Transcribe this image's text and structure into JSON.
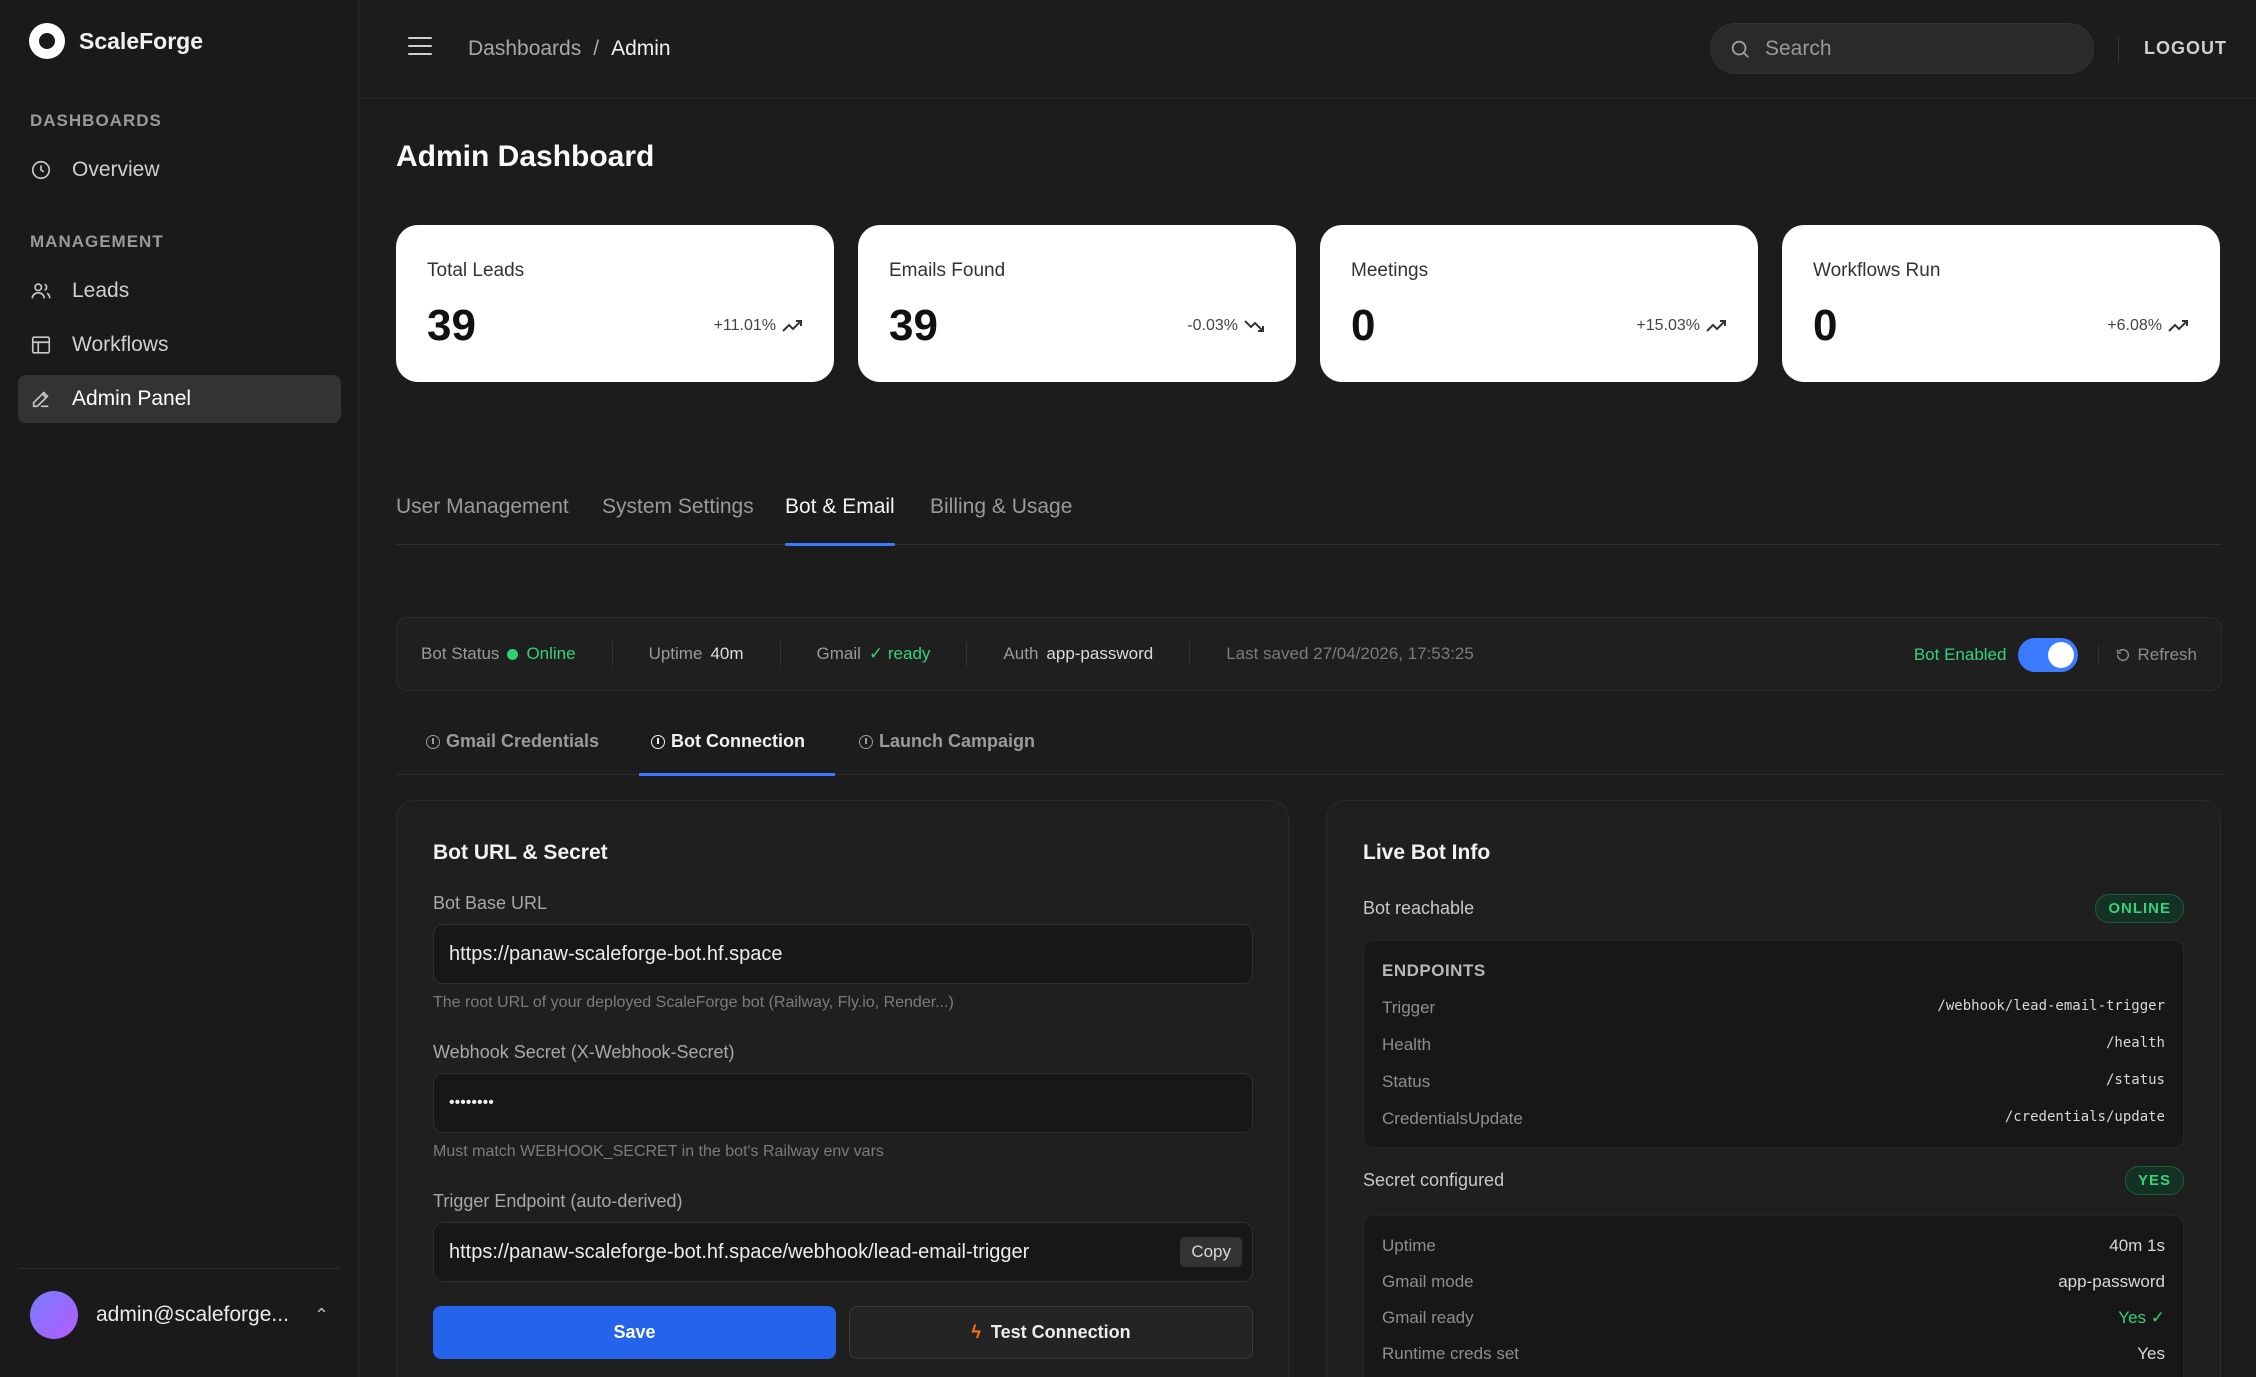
{
  "app": {
    "name": "ScaleForge"
  },
  "sidebar": {
    "sections": [
      {
        "title": "DASHBOARDS",
        "items": [
          {
            "label": "Overview",
            "icon": "clock-icon"
          }
        ]
      },
      {
        "title": "MANAGEMENT",
        "items": [
          {
            "label": "Leads",
            "icon": "users-icon"
          },
          {
            "label": "Workflows",
            "icon": "table-icon"
          },
          {
            "label": "Admin Panel",
            "icon": "pen-icon",
            "active": true
          }
        ]
      }
    ],
    "user": {
      "email": "admin@scaleforge...",
      "chevron": "⌃"
    }
  },
  "topbar": {
    "breadcrumb": [
      "Dashboards",
      "/",
      "Admin"
    ],
    "search_placeholder": "Search",
    "logout_label": "LOGOUT"
  },
  "page": {
    "title": "Admin Dashboard"
  },
  "stats": [
    {
      "label": "Total Leads",
      "value": "39",
      "delta": "+11.01%",
      "trend": "up"
    },
    {
      "label": "Emails Found",
      "value": "39",
      "delta": "-0.03%",
      "trend": "down"
    },
    {
      "label": "Meetings",
      "value": "0",
      "delta": "+15.03%",
      "trend": "up"
    },
    {
      "label": "Workflows Run",
      "value": "0",
      "delta": "+6.08%",
      "trend": "up"
    }
  ],
  "tabs": [
    {
      "label": "User Management"
    },
    {
      "label": "System Settings"
    },
    {
      "label": "Bot & Email",
      "active": true
    },
    {
      "label": "Billing & Usage"
    }
  ],
  "status_bar": {
    "bot_status_label": "Bot Status",
    "bot_status_value": "Online",
    "uptime_label": "Uptime",
    "uptime_value": "40m",
    "gmail_label": "Gmail",
    "gmail_value": "✓ ready",
    "auth_label": "Auth",
    "auth_value": "app-password",
    "last_saved": "Last saved 27/04/2026, 17:53:25",
    "bot_enabled_label": "Bot Enabled",
    "refresh_label": "Refresh"
  },
  "subtabs": [
    {
      "label": "Gmail Credentials"
    },
    {
      "label": "Bot Connection",
      "active": true
    },
    {
      "label": "Launch Campaign"
    }
  ],
  "bot_form": {
    "title": "Bot URL & Secret",
    "base_url_label": "Bot Base URL",
    "base_url_value": "https://panaw-scaleforge-bot.hf.space",
    "base_url_hint": "The root URL of your deployed ScaleForge bot (Railway, Fly.io, Render...)",
    "secret_label": "Webhook Secret (X-Webhook-Secret)",
    "secret_value": "••••••••",
    "secret_hint": "Must match WEBHOOK_SECRET in the bot's Railway env vars",
    "trigger_label": "Trigger Endpoint (auto-derived)",
    "trigger_value": "https://panaw-scaleforge-bot.hf.space/webhook/lead-email-trigger",
    "copy_label": "Copy",
    "save_label": "Save",
    "test_label": "Test Connection"
  },
  "live_info": {
    "title": "Live Bot Info",
    "reachable_label": "Bot reachable",
    "reachable_badge": "ONLINE",
    "endpoints_title": "ENDPOINTS",
    "endpoints": [
      {
        "name": "Trigger",
        "path": "/webhook/lead-email-trigger"
      },
      {
        "name": "Health",
        "path": "/health"
      },
      {
        "name": "Status",
        "path": "/status"
      },
      {
        "name": "CredentialsUpdate",
        "path": "/credentials/update"
      }
    ],
    "secret_label": "Secret configured",
    "secret_badge": "YES",
    "details": [
      {
        "name": "Uptime",
        "value": "40m 1s"
      },
      {
        "name": "Gmail mode",
        "value": "app-password"
      },
      {
        "name": "Gmail ready",
        "value": "Yes ✓"
      },
      {
        "name": "Runtime creds set",
        "value": "Yes"
      }
    ]
  },
  "colors": {
    "accent": "#3b7bff",
    "primary_button": "#2563eb",
    "success": "#34d27a",
    "background": "#1c1c1c"
  }
}
